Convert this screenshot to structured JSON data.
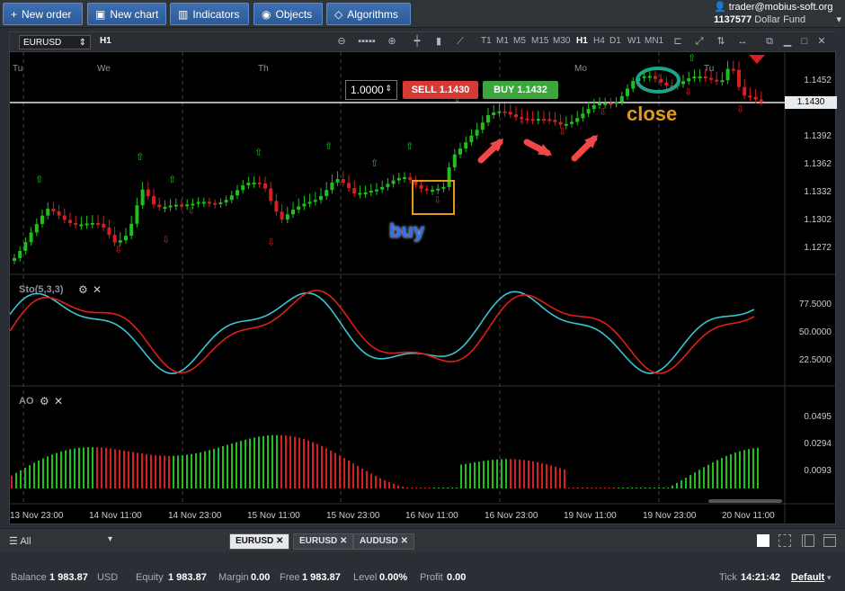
{
  "toolbar": {
    "new_order": "New order",
    "new_chart": "New chart",
    "indicators": "Indicators",
    "objects": "Objects",
    "algorithms": "Algorithms"
  },
  "account": {
    "email": "trader@mobius-soft.org",
    "number": "1137577",
    "fund": "Dollar Fund"
  },
  "chart": {
    "symbol": "EURUSD",
    "period": "H1",
    "timeframes": [
      "T1",
      "M1",
      "M5",
      "M15",
      "M30",
      "H1",
      "H4",
      "D1",
      "W1",
      "MN1"
    ],
    "active_timeframe": "H1",
    "quantity": "1.0000",
    "sell_label": "SELL 1.1430",
    "buy_label": "BUY 1.1432",
    "current_price": "1.1430",
    "day_labels": [
      "Tu",
      "We",
      "Th",
      "Mo",
      "Tu"
    ],
    "price_ticks": [
      "1.1452",
      "1.1392",
      "1.1362",
      "1.1332",
      "1.1302",
      "1.1272"
    ],
    "annotations": {
      "buy": "buy",
      "close": "close"
    },
    "colors": {
      "up": "#1fbf1f",
      "down": "#d42020",
      "buy_text": "#2f6ef0",
      "close_text": "#e39a1b",
      "box": "#e39a1b",
      "ellipse": "#1aa58a",
      "arrow": "#f04848"
    }
  },
  "stochastic": {
    "label": "Sto(5,3,3)",
    "ticks": [
      "77.5000",
      "50.0000",
      "22.5000"
    ],
    "colors": {
      "k": "#3ac4d0",
      "d": "#e01e1e"
    }
  },
  "ao": {
    "label": "AO",
    "ticks": [
      "0.0495",
      "0.0294",
      "0.0093"
    ]
  },
  "time_labels": [
    "13 Nov 23:00",
    "14 Nov 11:00",
    "14 Nov 23:00",
    "15 Nov 11:00",
    "15 Nov 23:00",
    "16 Nov 11:00",
    "16 Nov 23:00",
    "19 Nov 11:00",
    "19 Nov 23:00",
    "20 Nov 11:00"
  ],
  "workspace": {
    "filter": "All",
    "tabs": [
      "EURUSD",
      "EURUSD",
      "AUDUSD"
    ]
  },
  "status": {
    "balance_label": "Balance",
    "balance": "1 983.87",
    "currency": "USD",
    "equity_label": "Equity",
    "equity": "1 983.87",
    "margin_label": "Margin",
    "margin": "0.00",
    "free_label": "Free",
    "free": "1 983.87",
    "level_label": "Level",
    "level": "0.00%",
    "profit_label": "Profit",
    "profit": "0.00",
    "tick_label": "Tick",
    "time": "14:21:42",
    "profile": "Default"
  }
}
